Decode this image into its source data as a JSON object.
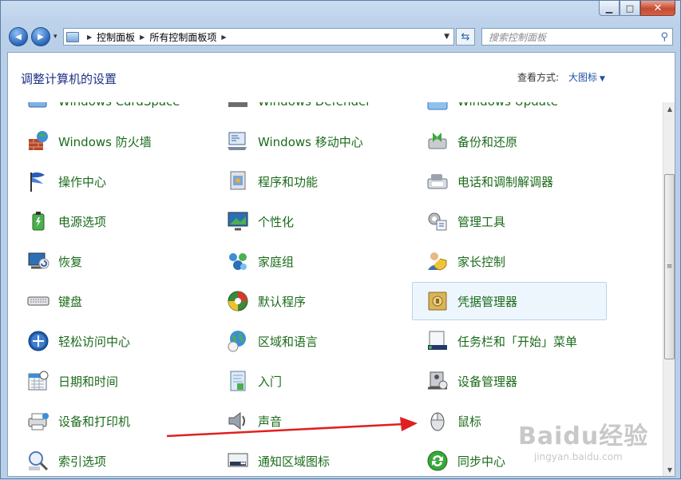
{
  "window": {
    "caption_buttons": [
      "minimize",
      "maximize",
      "close"
    ],
    "caption_glyphs": {
      "minimize": "▁",
      "maximize": "□",
      "close": "✕"
    }
  },
  "navigation": {
    "back_glyph": "◀",
    "forward_glyph": "▶",
    "history_glyph": "▾",
    "breadcrumbs": [
      "控制面板",
      "所有控制面板项"
    ],
    "crumb_sep": "▶",
    "address_dropdown_glyph": "▼",
    "refresh_glyph": "⇆",
    "search_placeholder": "搜索控制面板"
  },
  "header": {
    "title": "调整计算机的设置",
    "view_by_label": "查看方式:",
    "view_by_value": "大图标",
    "view_by_dd": "▼"
  },
  "items": [
    {
      "label": "Windows CardSpace",
      "icon": "cardspace-icon"
    },
    {
      "label": "Windows Defender",
      "icon": "defender-icon"
    },
    {
      "label": "Windows Update",
      "icon": "windows-update-icon"
    },
    {
      "label": "Windows 防火墙",
      "icon": "firewall-icon"
    },
    {
      "label": "Windows 移动中心",
      "icon": "mobility-center-icon"
    },
    {
      "label": "备份和还原",
      "icon": "backup-icon"
    },
    {
      "label": "操作中心",
      "icon": "action-center-flag-icon"
    },
    {
      "label": "程序和功能",
      "icon": "programs-icon"
    },
    {
      "label": "电话和调制解调器",
      "icon": "phone-modem-icon"
    },
    {
      "label": "电源选项",
      "icon": "power-options-icon"
    },
    {
      "label": "个性化",
      "icon": "personalization-icon"
    },
    {
      "label": "管理工具",
      "icon": "admin-tools-icon"
    },
    {
      "label": "恢复",
      "icon": "recovery-icon"
    },
    {
      "label": "家庭组",
      "icon": "homegroup-icon"
    },
    {
      "label": "家长控制",
      "icon": "parental-controls-icon"
    },
    {
      "label": "键盘",
      "icon": "keyboard-icon"
    },
    {
      "label": "默认程序",
      "icon": "default-programs-icon"
    },
    {
      "label": "凭据管理器",
      "icon": "credential-manager-icon",
      "selected": true
    },
    {
      "label": "轻松访问中心",
      "icon": "ease-of-access-icon"
    },
    {
      "label": "区域和语言",
      "icon": "region-language-icon"
    },
    {
      "label": "任务栏和「开始」菜单",
      "icon": "taskbar-icon"
    },
    {
      "label": "日期和时间",
      "icon": "date-time-icon"
    },
    {
      "label": "入门",
      "icon": "getting-started-icon"
    },
    {
      "label": "设备管理器",
      "icon": "device-manager-icon"
    },
    {
      "label": "设备和打印机",
      "icon": "devices-printers-icon"
    },
    {
      "label": "声音",
      "icon": "sound-icon"
    },
    {
      "label": "鼠标",
      "icon": "mouse-icon"
    },
    {
      "label": "索引选项",
      "icon": "indexing-icon"
    },
    {
      "label": "通知区域图标",
      "icon": "notification-icons-icon"
    },
    {
      "label": "同步中心",
      "icon": "sync-center-icon"
    }
  ],
  "scrollbar": {
    "up_glyph": "▲",
    "down_glyph": "▼",
    "grip": "≡"
  },
  "watermark": {
    "main": "Baidu经验",
    "sub": "jingyan.baidu.com"
  },
  "colors": {
    "item_text": "#1b6b1b",
    "heading": "#1e3287",
    "annotation_arrow": "#e02020"
  }
}
